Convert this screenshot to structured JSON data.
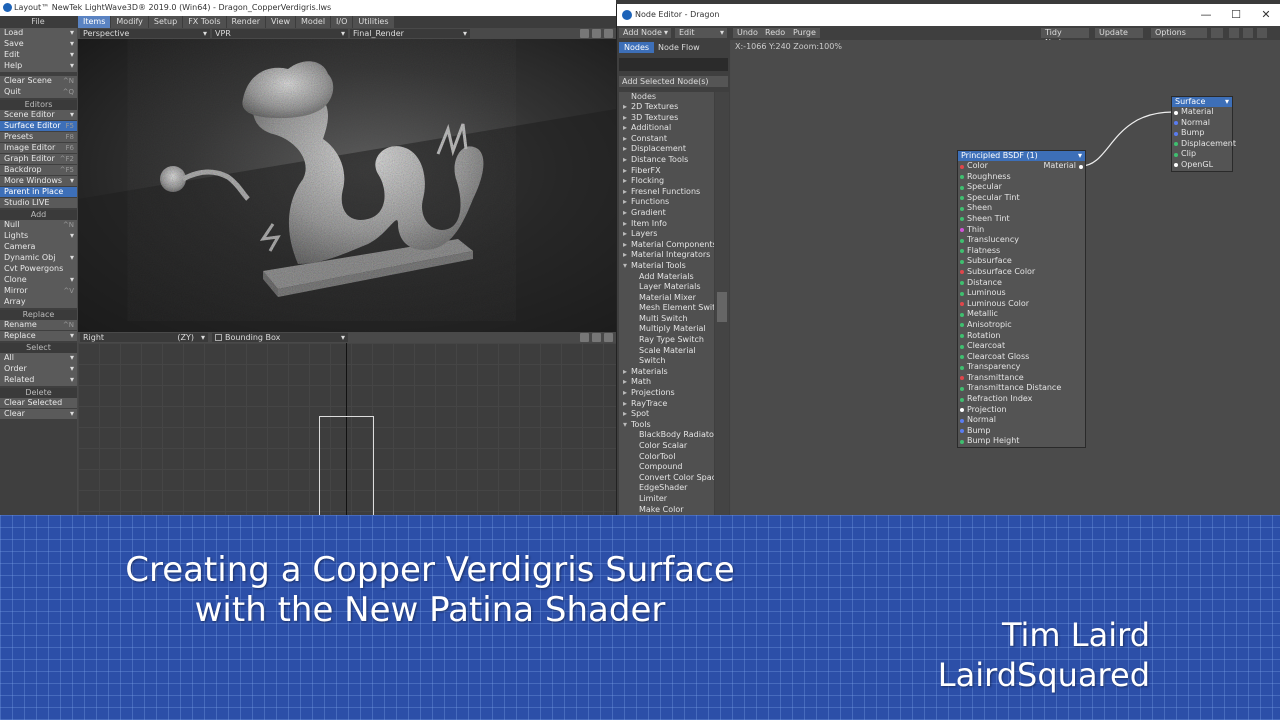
{
  "layout": {
    "title": "Layout™ NewTek LightWave3D® 2019.0 (Win64) - Dragon_CopperVerdigris.lws",
    "file_label": "File",
    "menu_tabs": [
      "Items",
      "Modify",
      "Setup",
      "FX Tools",
      "Render",
      "View",
      "Model",
      "I/O",
      "Utilities"
    ],
    "toolbar": {
      "file_items": [
        {
          "label": "Load",
          "arrow": true
        },
        {
          "label": "Save",
          "arrow": true
        },
        {
          "label": "Edit",
          "arrow": true
        },
        {
          "label": "Help",
          "arrow": true
        }
      ],
      "file_items2": [
        {
          "label": "Clear Scene",
          "key": "^N"
        },
        {
          "label": "Quit",
          "key": "^Q"
        }
      ],
      "editors_head": "Editors",
      "editors_items": [
        {
          "label": "Scene Editor",
          "arrow": true
        },
        {
          "label": "Surface Editor",
          "key": "F5",
          "selected": true
        },
        {
          "label": "Presets",
          "key": "F8"
        },
        {
          "label": "Image Editor",
          "key": "F6"
        },
        {
          "label": "Graph Editor",
          "key": "^F2"
        },
        {
          "label": "Backdrop",
          "key": "^F5"
        },
        {
          "label": "More Windows",
          "arrow": true
        },
        {
          "label": "Parent in Place",
          "selected": true
        },
        {
          "label": "Studio LIVE"
        }
      ],
      "add_head": "Add",
      "add_items": [
        {
          "label": "Null",
          "key": "^N"
        },
        {
          "label": "Lights",
          "arrow": true
        },
        {
          "label": "Camera"
        },
        {
          "label": "Dynamic Obj",
          "arrow": true
        },
        {
          "label": "Cvt Powergons"
        },
        {
          "label": "Clone",
          "arrow": true
        },
        {
          "label": "Mirror",
          "key": "^V"
        },
        {
          "label": "Array"
        }
      ],
      "replace_head": "Replace",
      "replace_items": [
        {
          "label": "Rename",
          "key": "^N"
        },
        {
          "label": "Replace",
          "arrow": true
        }
      ],
      "select_head": "Select",
      "select_items": [
        {
          "label": "All",
          "arrow": true
        },
        {
          "label": "Order",
          "arrow": true
        },
        {
          "label": "Related",
          "arrow": true
        }
      ],
      "delete_head": "Delete",
      "delete_items": [
        {
          "label": "Clear Selected"
        },
        {
          "label": "Clear",
          "arrow": true
        }
      ]
    },
    "viewport_top": {
      "view": "Perspective",
      "mode": "VPR",
      "camera": "Final_Render"
    },
    "viewport_bot": {
      "view": "Right",
      "axis": "(ZY)",
      "display": "Bounding Box"
    }
  },
  "node_editor": {
    "title": "Node Editor - Dragon",
    "toolbar": {
      "add_node": "Add Node",
      "edit": "Edit",
      "undo": "Undo",
      "redo": "Redo",
      "purge": "Purge",
      "tidy": "Tidy Nodes",
      "update": "Update",
      "options": "Options"
    },
    "tabs": [
      "Nodes",
      "Node Flow"
    ],
    "add_selected": "Add Selected Node(s)",
    "nodes_header": "Nodes",
    "coords": "X:-1066 Y:240 Zoom:100%",
    "node_list": [
      {
        "label": "2D Textures",
        "type": "cat",
        "open": false
      },
      {
        "label": "3D Textures",
        "type": "cat",
        "open": false
      },
      {
        "label": "Additional",
        "type": "cat",
        "open": false
      },
      {
        "label": "Constant",
        "type": "cat",
        "open": false
      },
      {
        "label": "Displacement",
        "type": "cat",
        "open": false
      },
      {
        "label": "Distance Tools",
        "type": "cat",
        "open": false
      },
      {
        "label": "FiberFX",
        "type": "cat",
        "open": false
      },
      {
        "label": "Flocking",
        "type": "cat",
        "open": false
      },
      {
        "label": "Fresnel Functions",
        "type": "cat",
        "open": false
      },
      {
        "label": "Functions",
        "type": "cat",
        "open": false
      },
      {
        "label": "Gradient",
        "type": "cat",
        "open": false
      },
      {
        "label": "Item Info",
        "type": "cat",
        "open": false
      },
      {
        "label": "Layers",
        "type": "cat",
        "open": false
      },
      {
        "label": "Material Components",
        "type": "cat",
        "open": false
      },
      {
        "label": "Material Integrators",
        "type": "cat",
        "open": false
      },
      {
        "label": "Material Tools",
        "type": "cat",
        "open": true
      },
      {
        "label": "Add Materials",
        "type": "sub"
      },
      {
        "label": "Layer Materials",
        "type": "sub"
      },
      {
        "label": "Material Mixer",
        "type": "sub"
      },
      {
        "label": "Mesh Element Switch",
        "type": "sub"
      },
      {
        "label": "Multi Switch",
        "type": "sub"
      },
      {
        "label": "Multiply Material",
        "type": "sub"
      },
      {
        "label": "Ray Type Switch",
        "type": "sub"
      },
      {
        "label": "Scale Material",
        "type": "sub"
      },
      {
        "label": "Switch",
        "type": "sub"
      },
      {
        "label": "Materials",
        "type": "cat",
        "open": false
      },
      {
        "label": "Math",
        "type": "cat",
        "open": false
      },
      {
        "label": "Projections",
        "type": "cat",
        "open": false
      },
      {
        "label": "RayTrace",
        "type": "cat",
        "open": false
      },
      {
        "label": "Spot",
        "type": "cat",
        "open": false
      },
      {
        "label": "Tools",
        "type": "cat",
        "open": true
      },
      {
        "label": "BlackBody Radiator",
        "type": "sub"
      },
      {
        "label": "Color Scalar",
        "type": "sub"
      },
      {
        "label": "ColorTool",
        "type": "sub"
      },
      {
        "label": "Compound",
        "type": "sub"
      },
      {
        "label": "Convert Color Space",
        "type": "sub"
      },
      {
        "label": "EdgeShader",
        "type": "sub"
      },
      {
        "label": "Limiter",
        "type": "sub"
      },
      {
        "label": "Make Color",
        "type": "sub"
      }
    ],
    "surface_node": {
      "title": "Surface",
      "inputs": [
        {
          "label": "Material",
          "color": "w"
        },
        {
          "label": "Normal",
          "color": "b"
        },
        {
          "label": "Bump",
          "color": "b"
        },
        {
          "label": "Displacement",
          "color": "g"
        },
        {
          "label": "Clip",
          "color": "g"
        },
        {
          "label": "OpenGL",
          "color": "w"
        }
      ]
    },
    "bsdf_node": {
      "title": "Principled BSDF (1)",
      "output": "Material",
      "inputs": [
        {
          "label": "Color",
          "color": "r"
        },
        {
          "label": "Roughness",
          "color": "g"
        },
        {
          "label": "Specular",
          "color": "g"
        },
        {
          "label": "Specular Tint",
          "color": "g"
        },
        {
          "label": "Sheen",
          "color": "g"
        },
        {
          "label": "Sheen Tint",
          "color": "g"
        },
        {
          "label": "Thin",
          "color": "m"
        },
        {
          "label": "Translucency",
          "color": "g"
        },
        {
          "label": "Flatness",
          "color": "g"
        },
        {
          "label": "Subsurface",
          "color": "g"
        },
        {
          "label": "Subsurface Color",
          "color": "r"
        },
        {
          "label": "Distance",
          "color": "g"
        },
        {
          "label": "Luminous",
          "color": "g"
        },
        {
          "label": "Luminous Color",
          "color": "r"
        },
        {
          "label": "Metallic",
          "color": "g"
        },
        {
          "label": "Anisotropic",
          "color": "g"
        },
        {
          "label": "Rotation",
          "color": "g"
        },
        {
          "label": "Clearcoat",
          "color": "g"
        },
        {
          "label": "Clearcoat Gloss",
          "color": "g"
        },
        {
          "label": "Transparency",
          "color": "g"
        },
        {
          "label": "Transmittance",
          "color": "r"
        },
        {
          "label": "Transmittance Distance",
          "color": "g"
        },
        {
          "label": "Refraction Index",
          "color": "g"
        },
        {
          "label": "Projection",
          "color": "w"
        },
        {
          "label": "Normal",
          "color": "b"
        },
        {
          "label": "Bump",
          "color": "b"
        },
        {
          "label": "Bump Height",
          "color": "g"
        }
      ]
    }
  },
  "banner": {
    "title_line1": "Creating a Copper Verdigris Surface",
    "title_line2": "with the New Patina Shader",
    "author": "Tim Laird",
    "brand": "LairdSquared"
  },
  "colors": {
    "accent": "#3d6fb8",
    "banner_bg": "#2c4fa8"
  }
}
